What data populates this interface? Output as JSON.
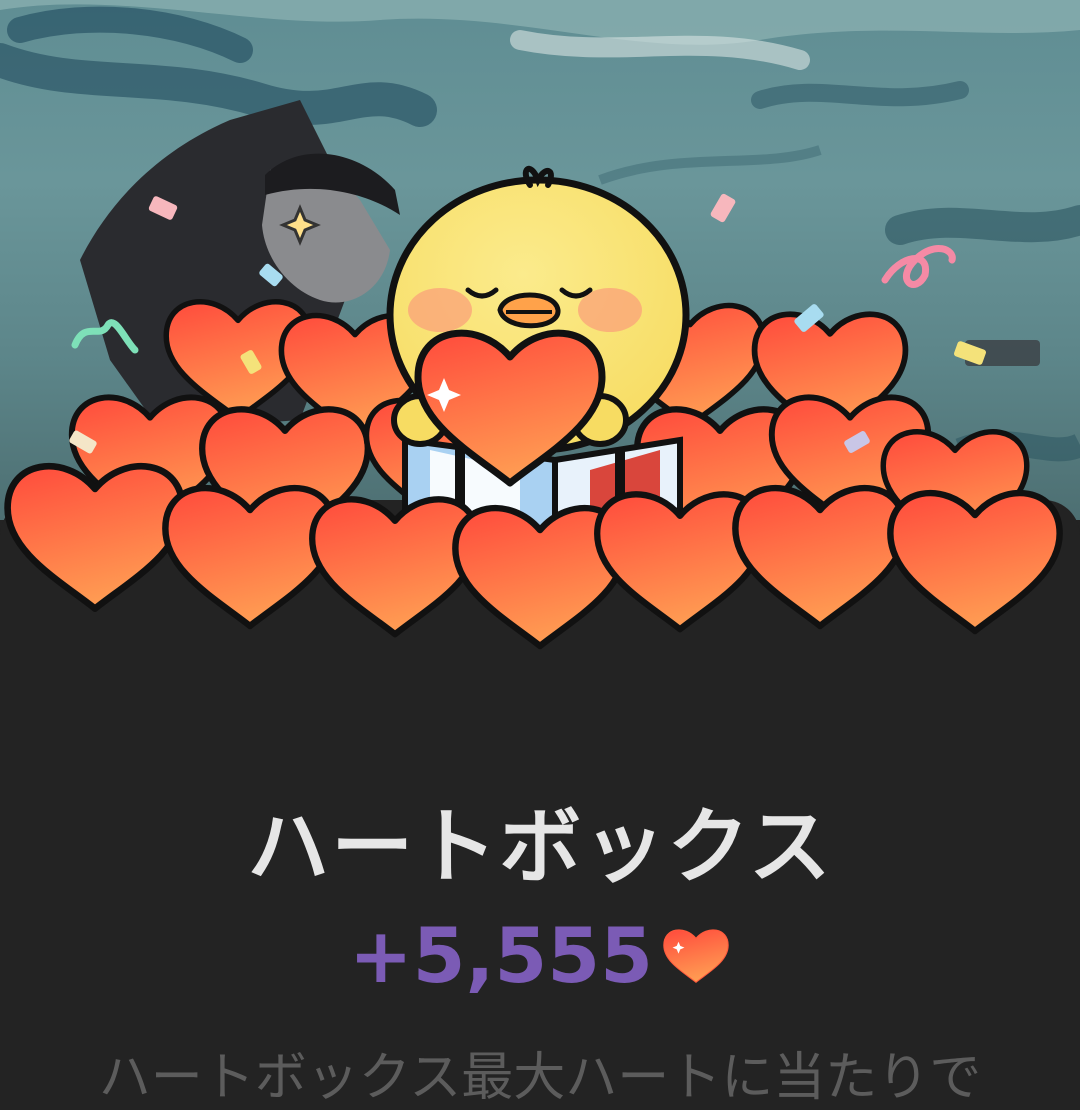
{
  "popup": {
    "title": "ハートボックス",
    "reward_amount": "+5,555",
    "description": "ハートボックス最大ハートに当たりで"
  },
  "icons": {
    "reward": "heart-icon",
    "mascot": "yellow-chick-mascot"
  },
  "colors": {
    "sheet_background": "#232323",
    "title_text": "#e6e6e6",
    "reward_text": "#7b5bb5",
    "description_text": "#5c5c5c",
    "heart_fill": "#ff6a45"
  }
}
